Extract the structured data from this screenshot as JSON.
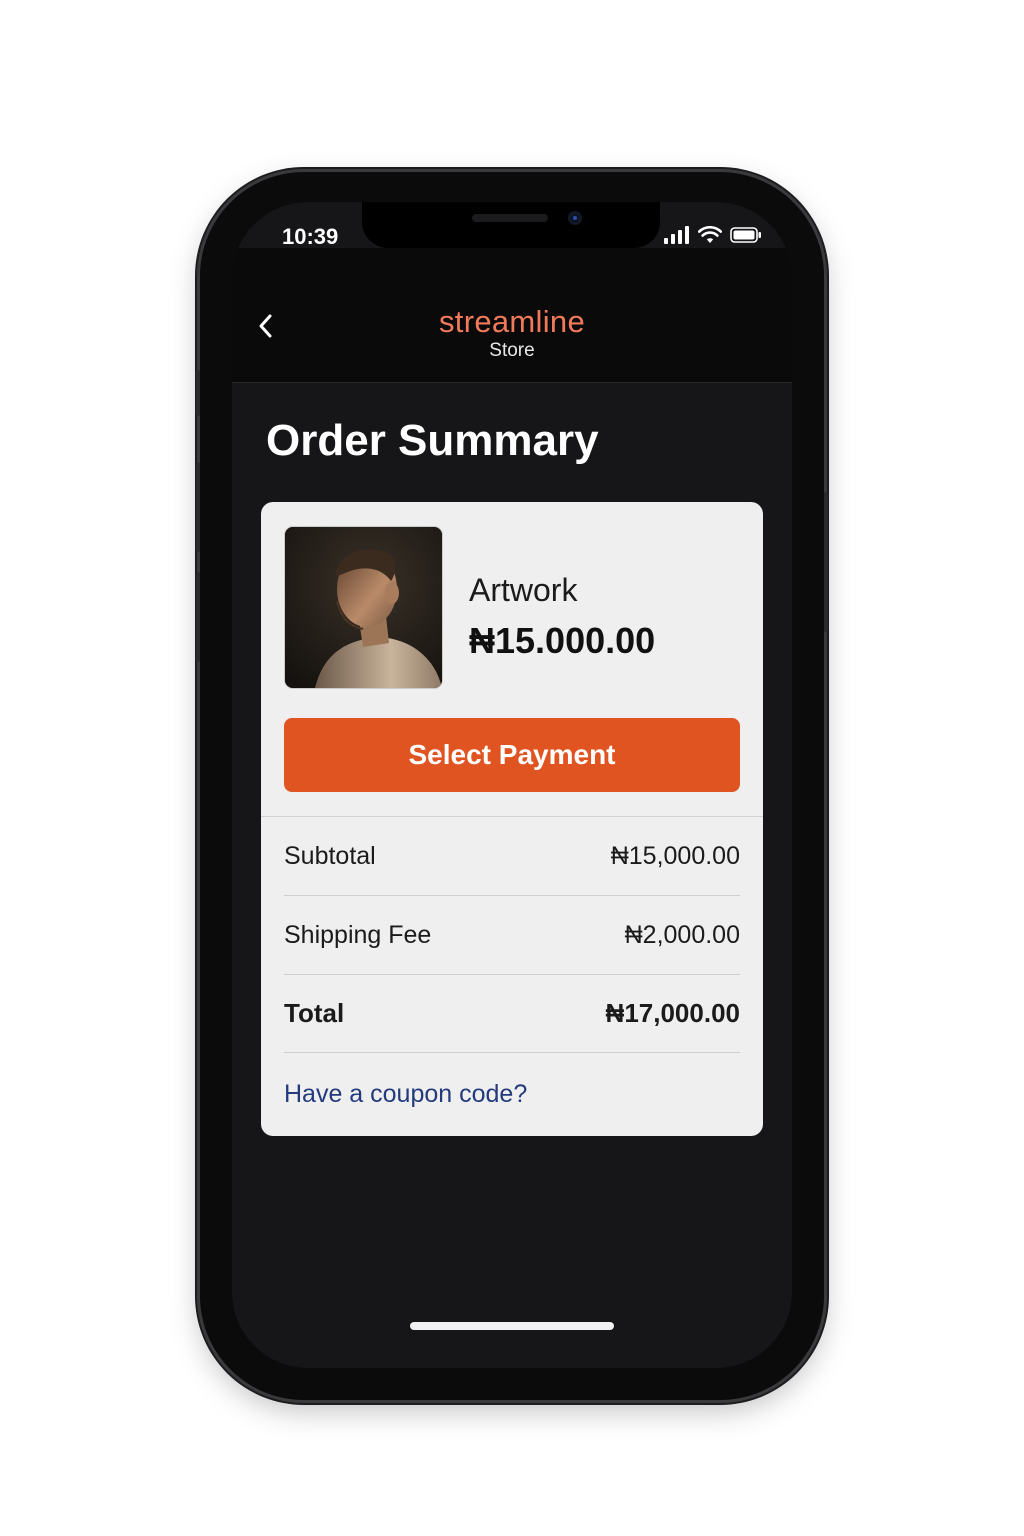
{
  "status_bar": {
    "time": "10:39"
  },
  "header": {
    "brand": "streamline",
    "brand_sub": "Store"
  },
  "page": {
    "title": "Order Summary"
  },
  "item": {
    "name": "Artwork",
    "price": "₦15.000.00"
  },
  "actions": {
    "select_payment": "Select Payment"
  },
  "summary": [
    {
      "label": "Subtotal",
      "value": "₦15,000.00"
    },
    {
      "label": "Shipping Fee",
      "value": "₦2,000.00"
    },
    {
      "label": "Total",
      "value": "₦17,000.00"
    }
  ],
  "coupon": {
    "link": "Have a coupon code?"
  },
  "colors": {
    "accent": "#e05422",
    "brand": "#f07a5a",
    "link": "#233a7d",
    "screen_bg": "#161618",
    "card_bg": "#efeff0"
  },
  "icons": [
    "back-chevron-icon",
    "signal-icon",
    "wifi-icon",
    "battery-icon"
  ]
}
